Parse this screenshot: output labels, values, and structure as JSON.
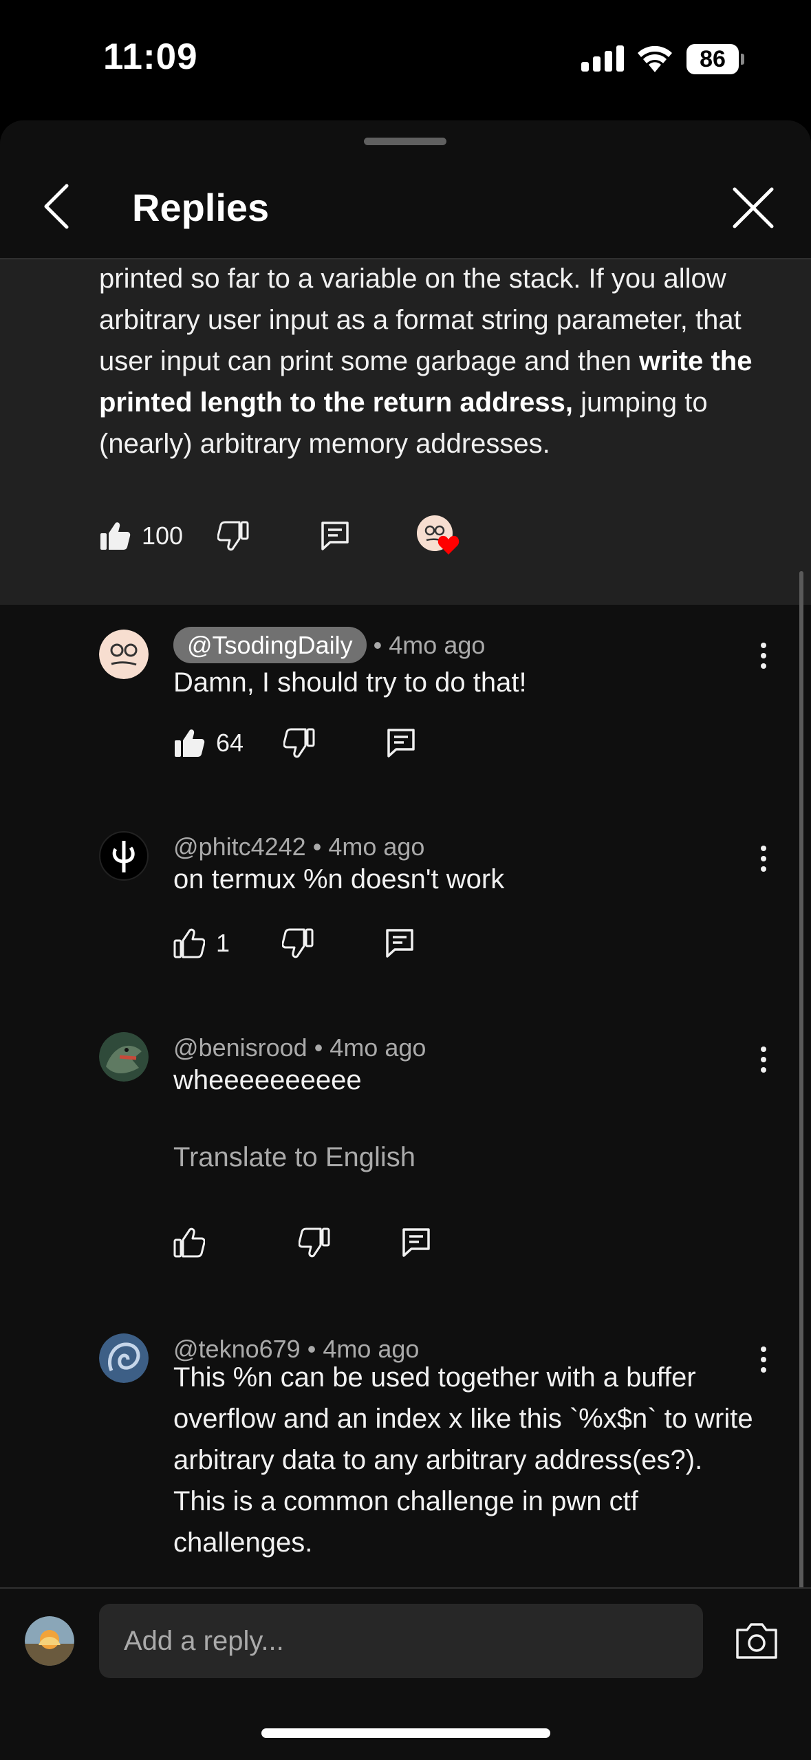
{
  "status_bar": {
    "time": "11:09",
    "battery": "86"
  },
  "header": {
    "title": "Replies"
  },
  "parent_comment": {
    "text_parts": [
      {
        "text": "printed so far to a variable on the stack. If you allow arbitrary user input as a format string parameter, that user input can print some garbage and then ",
        "bold": false
      },
      {
        "text": "write the printed length to the return address,",
        "bold": true
      },
      {
        "text": " jumping to (nearly) arbitrary memory addresses.",
        "bold": false
      }
    ],
    "likes": "100"
  },
  "replies": [
    {
      "author": "@TsodingDaily",
      "age": "4mo ago",
      "text": "Damn, I should try to do that!",
      "likes": "64",
      "creator": true
    },
    {
      "author": "@phitc4242",
      "age": "4mo ago",
      "text": "on termux %n doesn't work",
      "likes": "1"
    },
    {
      "author": "@benisrood",
      "age": "4mo ago",
      "text": "wheeeeeeeeee",
      "translate": "Translate to English",
      "likes": ""
    },
    {
      "author": "@tekno679",
      "age": "4mo ago",
      "text": "This %n can be used together with a buffer overflow and an index x like this `%x$n` to write arbitrary data to any arbitrary address(es?). This is a common challenge in pwn ctf challenges."
    }
  ],
  "composer": {
    "placeholder": "Add a reply..."
  },
  "icons": {
    "like": "thumbs-up-icon",
    "dislike": "thumbs-down-icon",
    "reply": "comment-icon",
    "heart": "creator-heart-icon",
    "more": "more-vert-icon",
    "back": "chevron-left-icon",
    "close": "close-icon",
    "camera": "camera-icon"
  },
  "colors": {
    "background": "#0f0f0f",
    "highlight": "#212121",
    "heart": "#ff0000",
    "creator_chip": "#717171"
  }
}
